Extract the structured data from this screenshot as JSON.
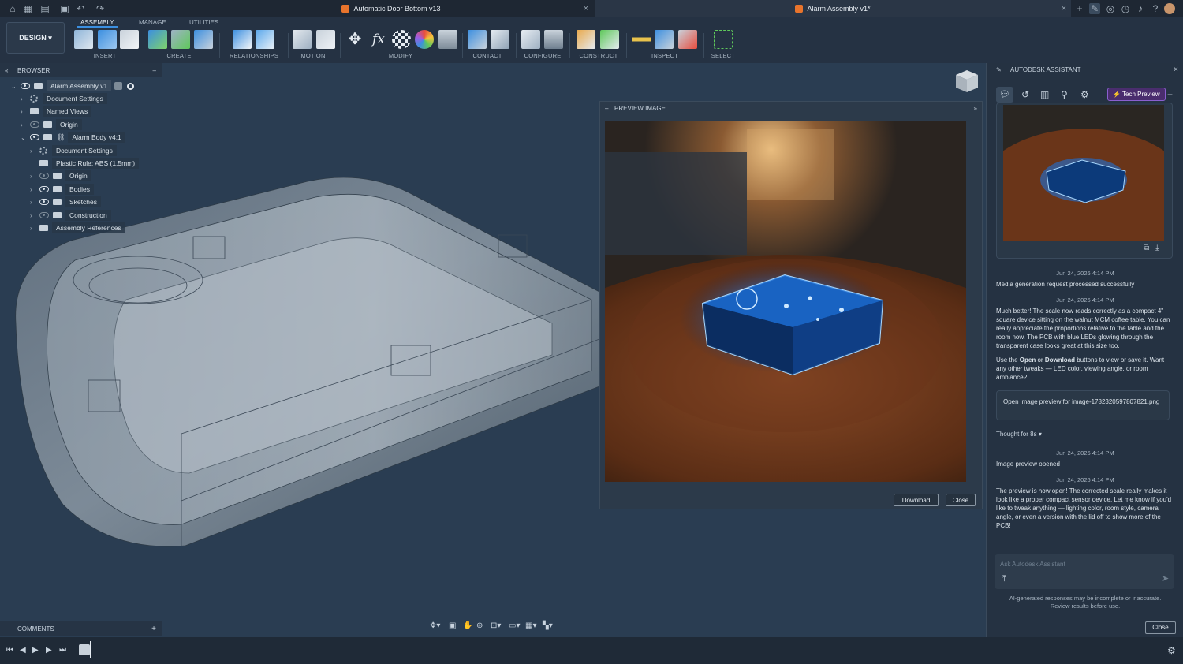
{
  "tabs": [
    {
      "title": "Automatic Door Bottom v13"
    },
    {
      "title": "Alarm Assembly v1*"
    }
  ],
  "toolbar": {
    "design_label": "DESIGN",
    "tabs": [
      "ASSEMBLY",
      "MANAGE",
      "UTILITIES"
    ],
    "groups": [
      "INSERT",
      "CREATE",
      "RELATIONSHIPS",
      "MOTION",
      "MODIFY",
      "CONTACT",
      "CONFIGURE",
      "CONSTRUCT",
      "INSPECT",
      "SELECT"
    ],
    "icons": [
      "insert-icon",
      "text-icon",
      "decal-icon",
      "new-component-icon",
      "sketch-icon",
      "joint-origin-icon",
      "rigid-group-icon",
      "joint-icon",
      "motion-link-icon",
      "drive-joints-icon",
      "move-icon",
      "parameters-icon",
      "appearance-icon",
      "physical-material-icon",
      "table-icon",
      "contact-sets-icon",
      "enable-contact-icon",
      "configure-icon",
      "configure-table-icon",
      "construct-plane-icon",
      "construct-axis-icon",
      "measure-icon",
      "section-analysis-icon",
      "interference-icon",
      "select-window-icon"
    ]
  },
  "browser": {
    "title": "BROWSER",
    "items": [
      {
        "label": "Alarm Assembly v1",
        "depth": 0,
        "expanded": true
      },
      {
        "label": "Document Settings",
        "depth": 1
      },
      {
        "label": "Named Views",
        "depth": 1
      },
      {
        "label": "Origin",
        "depth": 1
      },
      {
        "label": "Alarm Body v4:1",
        "depth": 1,
        "expanded": true
      },
      {
        "label": "Document Settings",
        "depth": 2
      },
      {
        "label": "Plastic Rule: ABS (1.5mm)",
        "depth": 2
      },
      {
        "label": "Origin",
        "depth": 2
      },
      {
        "label": "Bodies",
        "depth": 2
      },
      {
        "label": "Sketches",
        "depth": 2
      },
      {
        "label": "Construction",
        "depth": 2
      },
      {
        "label": "Assembly References",
        "depth": 2
      }
    ]
  },
  "preview": {
    "title": "PREVIEW IMAGE",
    "download_label": "Download",
    "close_label": "Close"
  },
  "assistant": {
    "title": "AUTODESK ASSISTANT",
    "tech_preview_label": "Tech Preview",
    "messages": [
      {
        "time": "Jun 24, 2026 4:14 PM",
        "text": "Media generation request processed successfully"
      },
      {
        "time": "Jun 24, 2026 4:14 PM",
        "text": "Much better! The scale now reads correctly as a compact 4\" square device sitting on the walnut MCM coffee table. You can really appreciate the proportions relative to the table and the room now. The PCB with blue LEDs glowing through the transparent case looks great at this size too."
      },
      {
        "text_pre": "Use the ",
        "bold1": "Open",
        "text_mid": " or ",
        "bold2": "Download",
        "text_post": " buttons to view or save it. Want any other tweaks — LED color, viewing angle, or room ambiance?"
      },
      {
        "card": "Open image preview for image-1782320597807821.png"
      },
      {
        "thought": "Thought for 8s"
      },
      {
        "time": "Jun 24, 2026 4:14 PM",
        "text": "Image preview opened"
      },
      {
        "time": "Jun 24, 2026 4:14 PM",
        "text": "The preview is now open! The corrected scale really makes it look like a proper compact sensor device. Let me know if you'd like to tweak anything — lighting color, room style, camera angle, or even a version with the lid off to show more of the PCB!"
      }
    ],
    "input_placeholder": "Ask Autodesk Assistant",
    "disclaimer": "AI-generated responses may be incomplete or inaccurate. Review results before use.",
    "close_label": "Close"
  },
  "comments": {
    "title": "COMMENTS"
  }
}
